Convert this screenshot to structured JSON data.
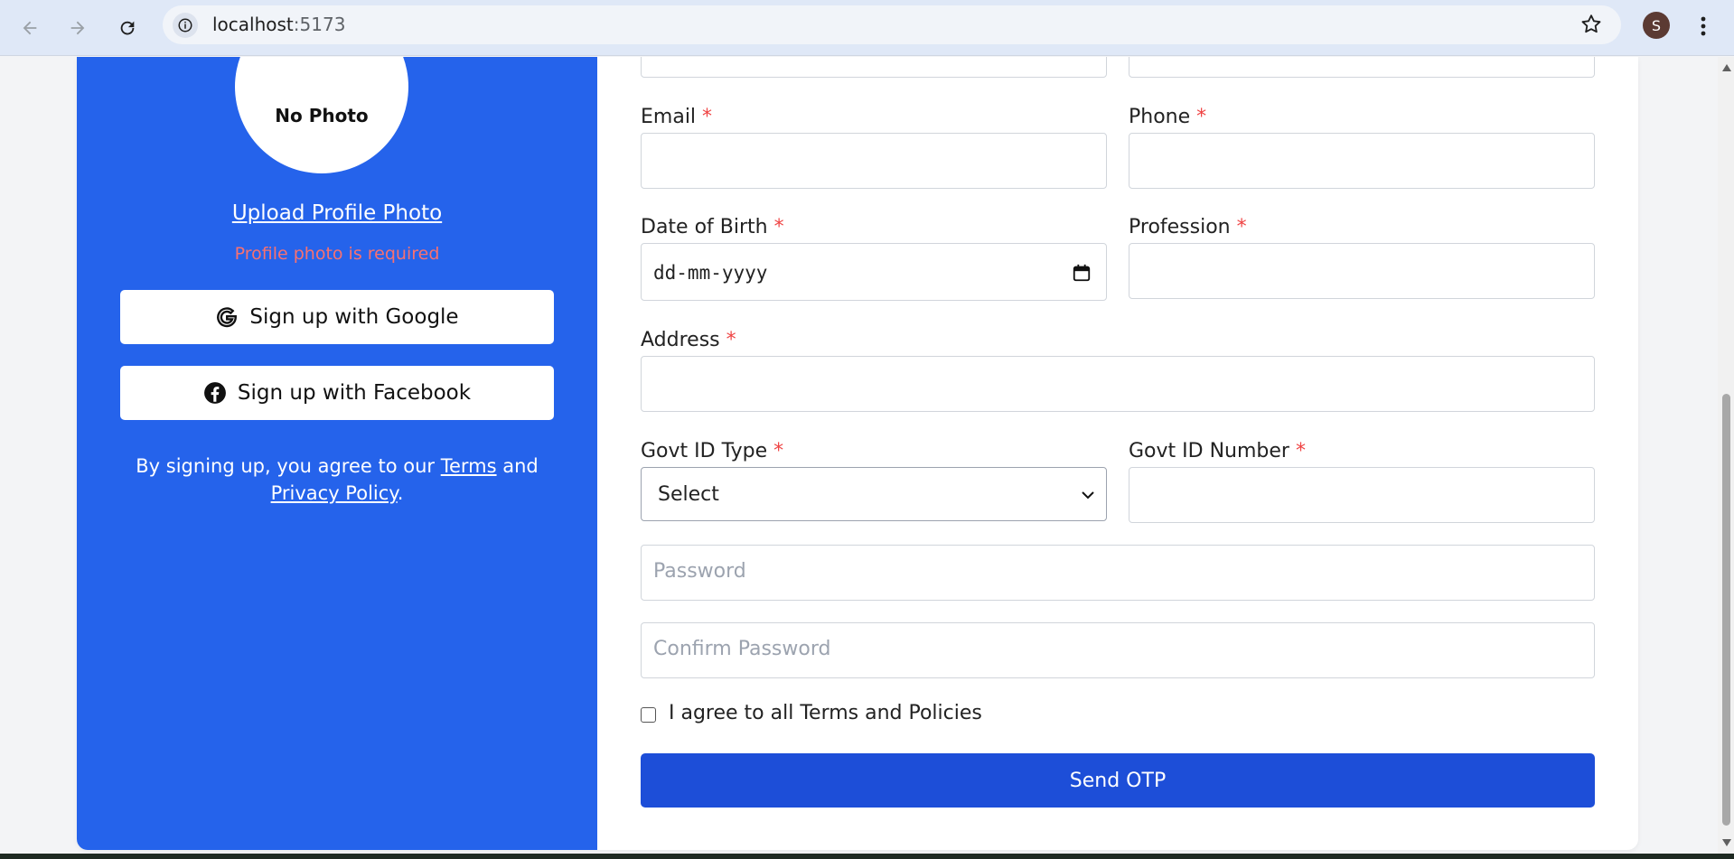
{
  "browser": {
    "url_host": "localhost",
    "url_port": ":5173",
    "profile_initial": "S"
  },
  "left_panel": {
    "photo_placeholder": "No Photo",
    "upload_link": "Upload Profile Photo",
    "error": "Profile photo is required",
    "google_button": "Sign up with Google",
    "facebook_button": "Sign up with Facebook",
    "agree_prefix": "By signing up, you agree to our ",
    "terms_link": "Terms",
    "agree_and": " and ",
    "privacy_link": "Privacy Policy",
    "agree_suffix": "."
  },
  "form": {
    "required_mark": "*",
    "email_label": "Email",
    "phone_label": "Phone",
    "dob_label": "Date of Birth",
    "dob_value": "dd-mm-yyyy",
    "profession_label": "Profession",
    "address_label": "Address",
    "govt_id_type_label": "Govt ID Type",
    "govt_id_type_value": "Select",
    "govt_id_number_label": "Govt ID Number",
    "password_placeholder": "Password",
    "confirm_password_placeholder": "Confirm Password",
    "terms_checkbox_label": "I agree to all Terms and Policies",
    "submit_button": "Send OTP"
  },
  "colors": {
    "panel_blue": "#2563eb",
    "button_blue": "#1d4ed8",
    "error_red": "#f87171",
    "required_red": "#ef4444"
  }
}
